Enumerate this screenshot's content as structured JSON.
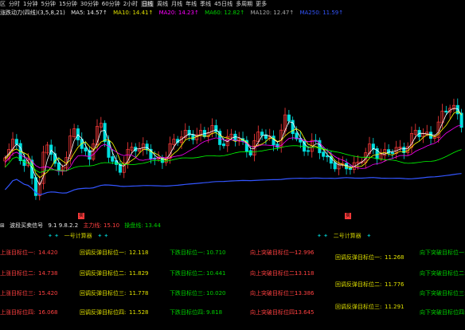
{
  "toolbar": {
    "items": [
      "区",
      "分时",
      "1分钟",
      "5分钟",
      "15分钟",
      "30分钟",
      "60分钟",
      "2小时",
      "日线",
      "周线",
      "月线",
      "年线",
      "季线",
      "45日线",
      "多周期",
      "更多"
    ],
    "active_index": 8
  },
  "ma_info": {
    "title": "涨跌动力(四线)(3,5,8,21)",
    "ma5": "MA5: 14.57↑",
    "ma10": "MA10: 14.41↑",
    "ma20": "MA20: 14.23↑",
    "ma60": "MA60: 12.82↑",
    "ma120": "MA120: 12.47↑",
    "ma250": "MA250: 11.59↑"
  },
  "indicator": {
    "title": "波段买卖信号",
    "value1": "9.1 9.8.2.2",
    "value2": "主力线: 15.10",
    "value3": "操盘线: 13.44"
  },
  "chart_data": {
    "type": "candlestick",
    "badges": [
      "卖",
      "卖"
    ],
    "lines": [
      {
        "color": "#ffffff"
      },
      {
        "color": "#ffff00"
      },
      {
        "color": "#ff00ff"
      },
      {
        "color": "#00ff00"
      },
      {
        "color": "#3355ff"
      }
    ]
  },
  "calc_headers": {
    "left": "一号计算器",
    "right": "二号计算器"
  },
  "left_calc": {
    "col1_labels": [
      "上涨目标位一:",
      "上涨目标位二:",
      "上涨目标位三:",
      "上涨目标位四:"
    ],
    "col1_values": [
      "14.420",
      "14.738",
      "15.420",
      "16.068"
    ],
    "col2_labels": [
      "回调反弹目标位一:",
      "回调反弹目标位二:",
      "回调反弹目标位三:",
      "回调反弹目标位四:"
    ],
    "col2_values": [
      "12.118",
      "11.829",
      "11.778",
      "11.528"
    ],
    "col3_labels": [
      "下跌目标位一:",
      "下跌目标位二:",
      "下跌目标位三:",
      "下跌目标位四:"
    ],
    "col3_values": [
      "10.710",
      "10.441",
      "10.020",
      "9.818"
    ]
  },
  "right_calc": {
    "col1_labels": [
      "向上突破目标位一:",
      "向上突破目标位二:",
      "向上突破目标位三:",
      "向上突破目标位四:"
    ],
    "col1_values": [
      "12.996",
      "13.118",
      "13.386",
      "13.645"
    ],
    "col2_labels": [
      "回调反弹目标位一:",
      "回调反弹目标位二:",
      "回调反弹目标位三:"
    ],
    "col2_values": [
      "11.268",
      "11.776",
      "11.291"
    ],
    "col3_labels": [
      "向下突破目标位一:",
      "向下突破目标位二:",
      "向下突破目标位三:",
      "向下突破目标位四:"
    ]
  },
  "colors": {
    "background": "#000000",
    "up": "#ff3b3b",
    "down": "#00e0e0",
    "label_red": "#ff4040",
    "label_yellow": "#e0e000",
    "label_green": "#00d000"
  }
}
